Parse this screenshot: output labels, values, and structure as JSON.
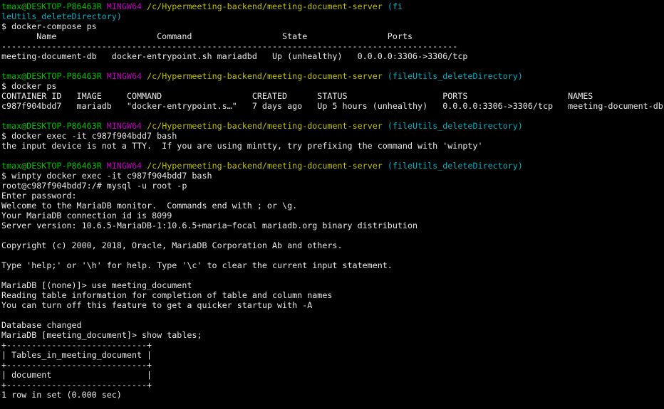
{
  "colors": {
    "background": "#000000",
    "default_text": "#c0c0c0",
    "user_host": "#00c000",
    "shell_name": "#c000c0",
    "path": "#c0c000",
    "branch": "#00b0c0",
    "output": "#e8e8e8"
  },
  "lines": [
    {
      "segments": [
        {
          "text": "tmax@DESKTOP-P86463R",
          "color": "green"
        },
        {
          "text": " ",
          "color": "grey"
        },
        {
          "text": "MINGW64",
          "color": "magenta"
        },
        {
          "text": " ",
          "color": "grey"
        },
        {
          "text": "/c/Hypermeeting-backend/meeting-document-server",
          "color": "yellow"
        },
        {
          "text": " (fi",
          "color": "cyan"
        }
      ]
    },
    {
      "segments": [
        {
          "text": "leUtils_deleteDirectory)",
          "color": "cyan"
        }
      ]
    },
    {
      "segments": [
        {
          "text": "$ docker-compose ps",
          "color": "white"
        }
      ]
    },
    {
      "segments": [
        {
          "text": "       Name                    Command                  State                Ports",
          "color": "white"
        }
      ]
    },
    {
      "segments": [
        {
          "text": "-------------------------------------------------------------------------------------------",
          "color": "white"
        }
      ]
    },
    {
      "segments": [
        {
          "text": "meeting-document-db   docker-entrypoint.sh mariadbd   Up (unhealthy)   0.0.0.0:3306->3306/tcp",
          "color": "white"
        }
      ]
    },
    {
      "segments": [
        {
          "text": "",
          "color": "white"
        }
      ]
    },
    {
      "segments": [
        {
          "text": "tmax@DESKTOP-P86463R",
          "color": "green"
        },
        {
          "text": " ",
          "color": "grey"
        },
        {
          "text": "MINGW64",
          "color": "magenta"
        },
        {
          "text": " ",
          "color": "grey"
        },
        {
          "text": "/c/Hypermeeting-backend/meeting-document-server",
          "color": "yellow"
        },
        {
          "text": " (fileUtils_deleteDirectory)",
          "color": "cyan"
        }
      ]
    },
    {
      "segments": [
        {
          "text": "$ docker ps",
          "color": "white"
        }
      ]
    },
    {
      "segments": [
        {
          "text": "CONTAINER ID   IMAGE     COMMAND                  CREATED      STATUS                   PORTS                    NAMES",
          "color": "white"
        }
      ]
    },
    {
      "segments": [
        {
          "text": "c987f904bdd7   mariadb   \"docker-entrypoint.s…\"   7 days ago   Up 5 hours (unhealthy)   0.0.0.0:3306->3306/tcp   meeting-document-db",
          "color": "white"
        }
      ]
    },
    {
      "segments": [
        {
          "text": "",
          "color": "white"
        }
      ]
    },
    {
      "segments": [
        {
          "text": "tmax@DESKTOP-P86463R",
          "color": "green"
        },
        {
          "text": " ",
          "color": "grey"
        },
        {
          "text": "MINGW64",
          "color": "magenta"
        },
        {
          "text": " ",
          "color": "grey"
        },
        {
          "text": "/c/Hypermeeting-backend/meeting-document-server",
          "color": "yellow"
        },
        {
          "text": " (fileUtils_deleteDirectory)",
          "color": "cyan"
        }
      ]
    },
    {
      "segments": [
        {
          "text": "$ docker exec -it c987f904bdd7 bash",
          "color": "white"
        }
      ]
    },
    {
      "segments": [
        {
          "text": "the input device is not a TTY.  If you are using mintty, try prefixing the command with 'winpty'",
          "color": "white"
        }
      ]
    },
    {
      "segments": [
        {
          "text": "",
          "color": "white"
        }
      ]
    },
    {
      "segments": [
        {
          "text": "tmax@DESKTOP-P86463R",
          "color": "green"
        },
        {
          "text": " ",
          "color": "grey"
        },
        {
          "text": "MINGW64",
          "color": "magenta"
        },
        {
          "text": " ",
          "color": "grey"
        },
        {
          "text": "/c/Hypermeeting-backend/meeting-document-server",
          "color": "yellow"
        },
        {
          "text": " (fileUtils_deleteDirectory)",
          "color": "cyan"
        }
      ]
    },
    {
      "segments": [
        {
          "text": "$ winpty docker exec -it c987f904bdd7 bash",
          "color": "white"
        }
      ]
    },
    {
      "segments": [
        {
          "text": "root@c987f904bdd7:/# mysql -u root -p",
          "color": "white"
        }
      ]
    },
    {
      "segments": [
        {
          "text": "Enter password:",
          "color": "white"
        }
      ]
    },
    {
      "segments": [
        {
          "text": "Welcome to the MariaDB monitor.  Commands end with ; or \\g.",
          "color": "white"
        }
      ]
    },
    {
      "segments": [
        {
          "text": "Your MariaDB connection id is 8099",
          "color": "white"
        }
      ]
    },
    {
      "segments": [
        {
          "text": "Server version: 10.6.5-MariaDB-1:10.6.5+maria~focal mariadb.org binary distribution",
          "color": "white"
        }
      ]
    },
    {
      "segments": [
        {
          "text": "",
          "color": "white"
        }
      ]
    },
    {
      "segments": [
        {
          "text": "Copyright (c) 2000, 2018, Oracle, MariaDB Corporation Ab and others.",
          "color": "white"
        }
      ]
    },
    {
      "segments": [
        {
          "text": "",
          "color": "white"
        }
      ]
    },
    {
      "segments": [
        {
          "text": "Type 'help;' or '\\h' for help. Type '\\c' to clear the current input statement.",
          "color": "white"
        }
      ]
    },
    {
      "segments": [
        {
          "text": "",
          "color": "white"
        }
      ]
    },
    {
      "segments": [
        {
          "text": "MariaDB [(none)]> use meeting_document",
          "color": "white"
        }
      ]
    },
    {
      "segments": [
        {
          "text": "Reading table information for completion of table and column names",
          "color": "white"
        }
      ]
    },
    {
      "segments": [
        {
          "text": "You can turn off this feature to get a quicker startup with -A",
          "color": "white"
        }
      ]
    },
    {
      "segments": [
        {
          "text": "",
          "color": "white"
        }
      ]
    },
    {
      "segments": [
        {
          "text": "Database changed",
          "color": "white"
        }
      ]
    },
    {
      "segments": [
        {
          "text": "MariaDB [meeting_document]> show tables;",
          "color": "white"
        }
      ]
    },
    {
      "segments": [
        {
          "text": "+----------------------------+",
          "color": "white"
        }
      ]
    },
    {
      "segments": [
        {
          "text": "| Tables_in_meeting_document |",
          "color": "white"
        }
      ]
    },
    {
      "segments": [
        {
          "text": "+----------------------------+",
          "color": "white"
        }
      ]
    },
    {
      "segments": [
        {
          "text": "| document                   |",
          "color": "white"
        }
      ]
    },
    {
      "segments": [
        {
          "text": "+----------------------------+",
          "color": "white"
        }
      ]
    },
    {
      "segments": [
        {
          "text": "1 row in set (0.000 sec)",
          "color": "white"
        }
      ]
    }
  ]
}
